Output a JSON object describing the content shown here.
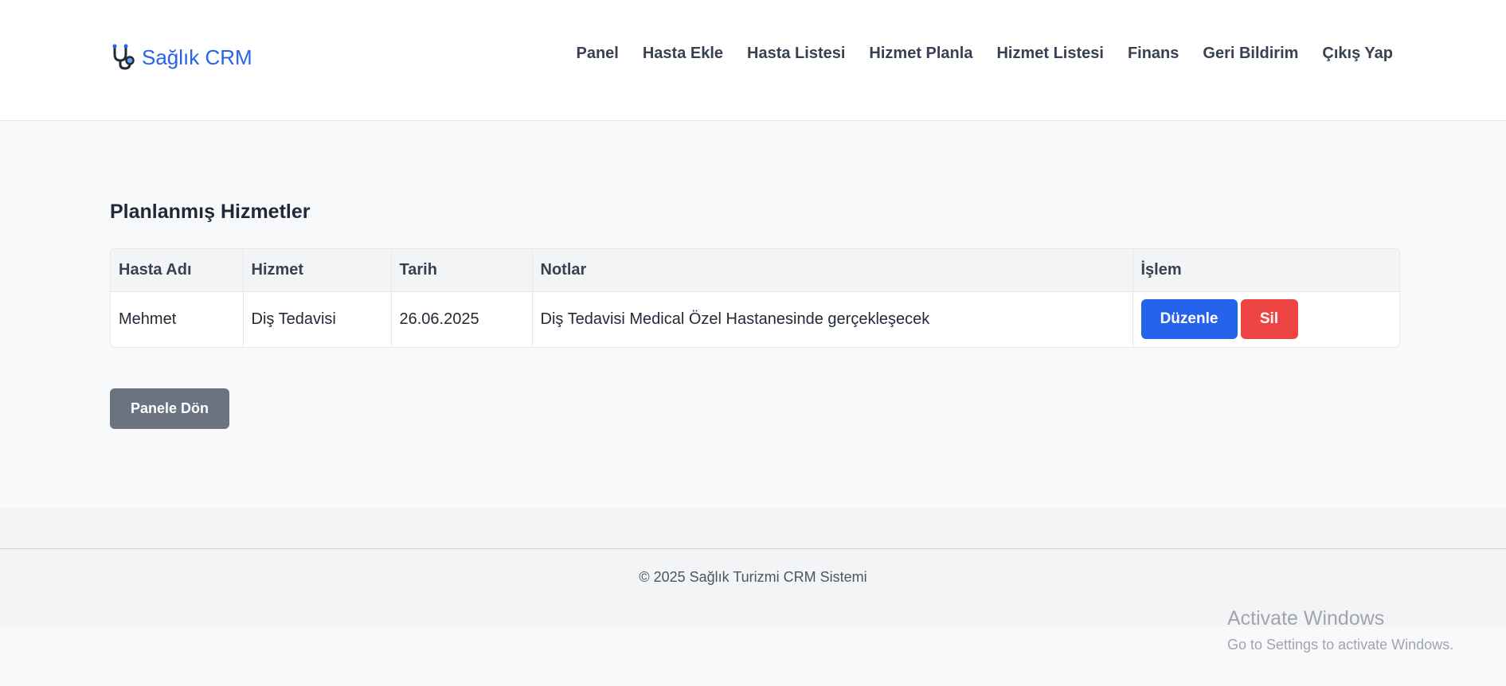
{
  "brand": {
    "icon": "stethoscope-icon",
    "name": "Sağlık CRM",
    "color": "#2563eb"
  },
  "nav": {
    "items": [
      "Panel",
      "Hasta Ekle",
      "Hasta Listesi",
      "Hizmet Planla",
      "Hizmet Listesi",
      "Finans",
      "Geri Bildirim",
      "Çıkış Yap"
    ]
  },
  "page": {
    "title": "Planlanmış Hizmetler"
  },
  "table": {
    "headers": [
      "Hasta Adı",
      "Hizmet",
      "Tarih",
      "Notlar",
      "İşlem"
    ],
    "rows": [
      {
        "patient": "Mehmet",
        "service": "Diş Tedavisi",
        "date": "26.06.2025",
        "notes": "Diş Tedavisi Medical Özel Hastanesinde gerçekleşecek",
        "edit_label": "Düzenle",
        "delete_label": "Sil"
      }
    ]
  },
  "actions": {
    "back_label": "Panele Dön"
  },
  "footer": {
    "text": "© 2025 Sağlık Turizmi CRM Sistemi"
  },
  "watermark": {
    "title": "Activate Windows",
    "subtitle": "Go to Settings to activate Windows."
  },
  "colors": {
    "primary": "#2563eb",
    "danger": "#ef4444",
    "secondary": "#6b7280"
  }
}
